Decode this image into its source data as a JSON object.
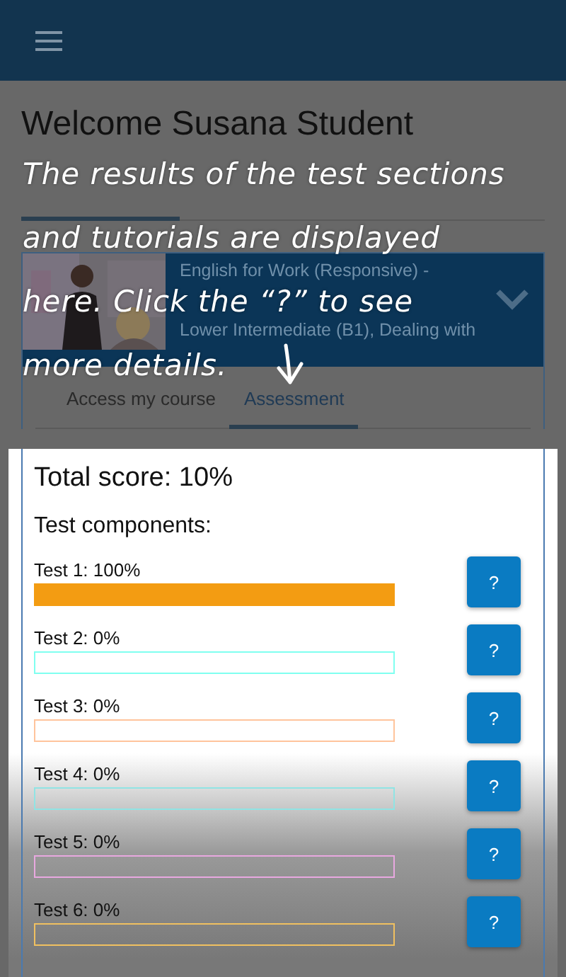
{
  "heading": "Welcome Susana Student",
  "tabs": [
    {
      "selected": true
    },
    {
      "selected": false
    },
    {
      "selected": false
    }
  ],
  "course": {
    "kind": "picture",
    "title": "English for Work (Responsive) -",
    "level_line": "Lower Intermediate (B1), Dealing with",
    "expanded": false,
    "tabs": [
      {
        "label": "Access my course",
        "selected": false
      },
      {
        "label": "Assessment",
        "selected": true
      }
    ]
  },
  "assessment": {
    "total": "Total score: 10%",
    "components_title": "Test components:",
    "tests": [
      {
        "label": "Test 1: 100%",
        "level": 1,
        "color": "#f39c12",
        "help": "?"
      },
      {
        "label": "Test 2: 0%",
        "level": 0,
        "color": "#80fff0",
        "help": "?"
      },
      {
        "label": "Test 3: 0%",
        "level": 0,
        "color": "#ffc49c",
        "help": "?"
      },
      {
        "label": "Test 4: 0%",
        "level": 0,
        "color": "#90e4e4",
        "help": "?"
      },
      {
        "label": "Test 5: 0%",
        "level": 0,
        "color": "#e8a8e0",
        "help": "?"
      },
      {
        "label": "Test 6: 0%",
        "level": 0,
        "color": "#f0c060",
        "help": "?"
      }
    ]
  },
  "callout_lines": [
    "The results of the test sections",
    "and tutorials are displayed",
    "here. Click the “?” to see",
    "more details."
  ]
}
